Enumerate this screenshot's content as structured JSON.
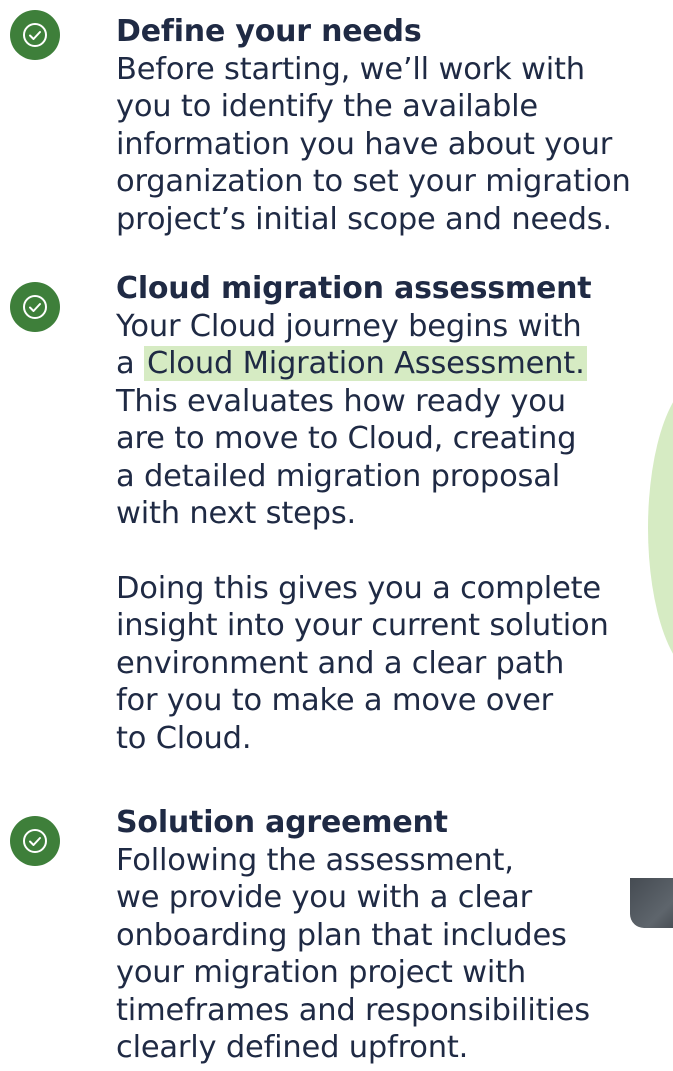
{
  "colors": {
    "check_bg": "#3e7f3a",
    "highlight_bg": "#d6ebc3",
    "text": "#1f2a44"
  },
  "steps": [
    {
      "icon": "check-circle-icon",
      "title": "Define your needs",
      "lines": [
        "Before starting, we’ll work with",
        "you to identify the available",
        "information you have about your",
        "organization to set your migration",
        "project’s initial scope and needs."
      ]
    },
    {
      "icon": "check-circle-icon",
      "title": "Cloud migration assessment",
      "line1": "Your Cloud journey begins with",
      "line2_prefix": "a",
      "link_text": "Cloud Migration Assessment.",
      "lines_after": [
        "This evaluates how ready you",
        "are to move to Cloud, creating",
        "a detailed migration proposal",
        "with next steps."
      ],
      "paragraph2": [
        "Doing this gives you a complete",
        "insight into your current solution",
        "environment and a clear path",
        "for you to make a move over",
        "to Cloud."
      ]
    },
    {
      "icon": "check-circle-icon",
      "title": "Solution agreement",
      "lines": [
        "Following the assessment,",
        "we provide you with a clear",
        "onboarding plan that includes",
        "your migration project with",
        "timeframes and responsibilities",
        "clearly defined upfront."
      ]
    }
  ]
}
